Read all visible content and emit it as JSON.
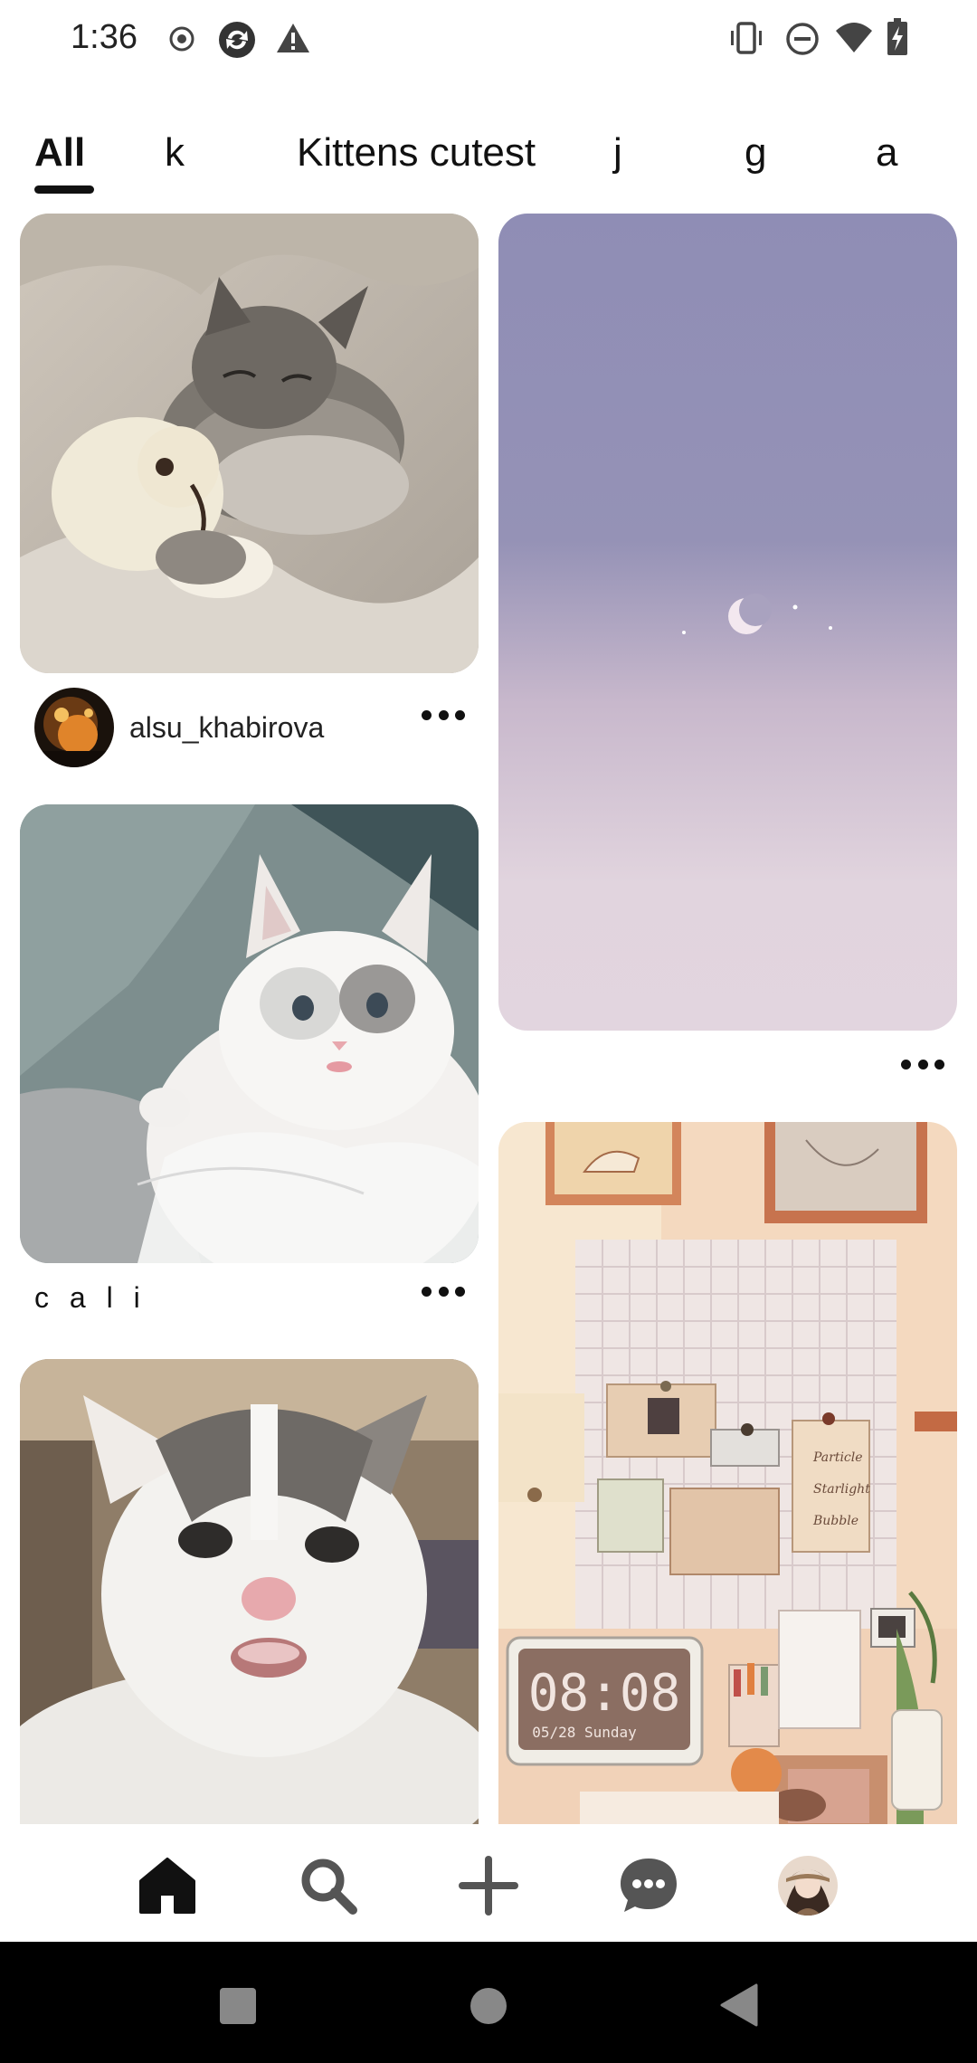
{
  "status_bar": {
    "time": "1:36",
    "icons_left": [
      "record-icon",
      "sync-icon",
      "warning-icon"
    ],
    "icons_right": [
      "vibrate-icon",
      "do-not-disturb-icon",
      "wifi-icon",
      "battery-charging-icon"
    ]
  },
  "tabs": [
    {
      "label": "All",
      "active": true
    },
    {
      "label": "k",
      "active": false
    },
    {
      "label": "Kittens cutest",
      "active": false
    },
    {
      "label": "j",
      "active": false
    },
    {
      "label": "g",
      "active": false
    },
    {
      "label": "a",
      "active": false
    }
  ],
  "feed": {
    "pins": [
      {
        "id": "sleeping-kitten",
        "username": "alsu_khabirova",
        "has_avatar": true
      },
      {
        "id": "night-sky",
        "username": "",
        "has_avatar": false
      },
      {
        "id": "fluffy-kitten",
        "title": "c a l i"
      },
      {
        "id": "desk-illustration",
        "clock_time": "08:08",
        "clock_date": "05/28 Sunday",
        "list_items": [
          "Particle",
          "Starlight",
          "Bubble"
        ]
      },
      {
        "id": "kitten-closeup"
      }
    ]
  },
  "bottom_nav": {
    "items": [
      "home-icon",
      "search-icon",
      "create-icon",
      "messages-icon",
      "profile-avatar"
    ],
    "active": "home-icon"
  },
  "system_nav": [
    "recents-button",
    "home-button",
    "back-button"
  ]
}
